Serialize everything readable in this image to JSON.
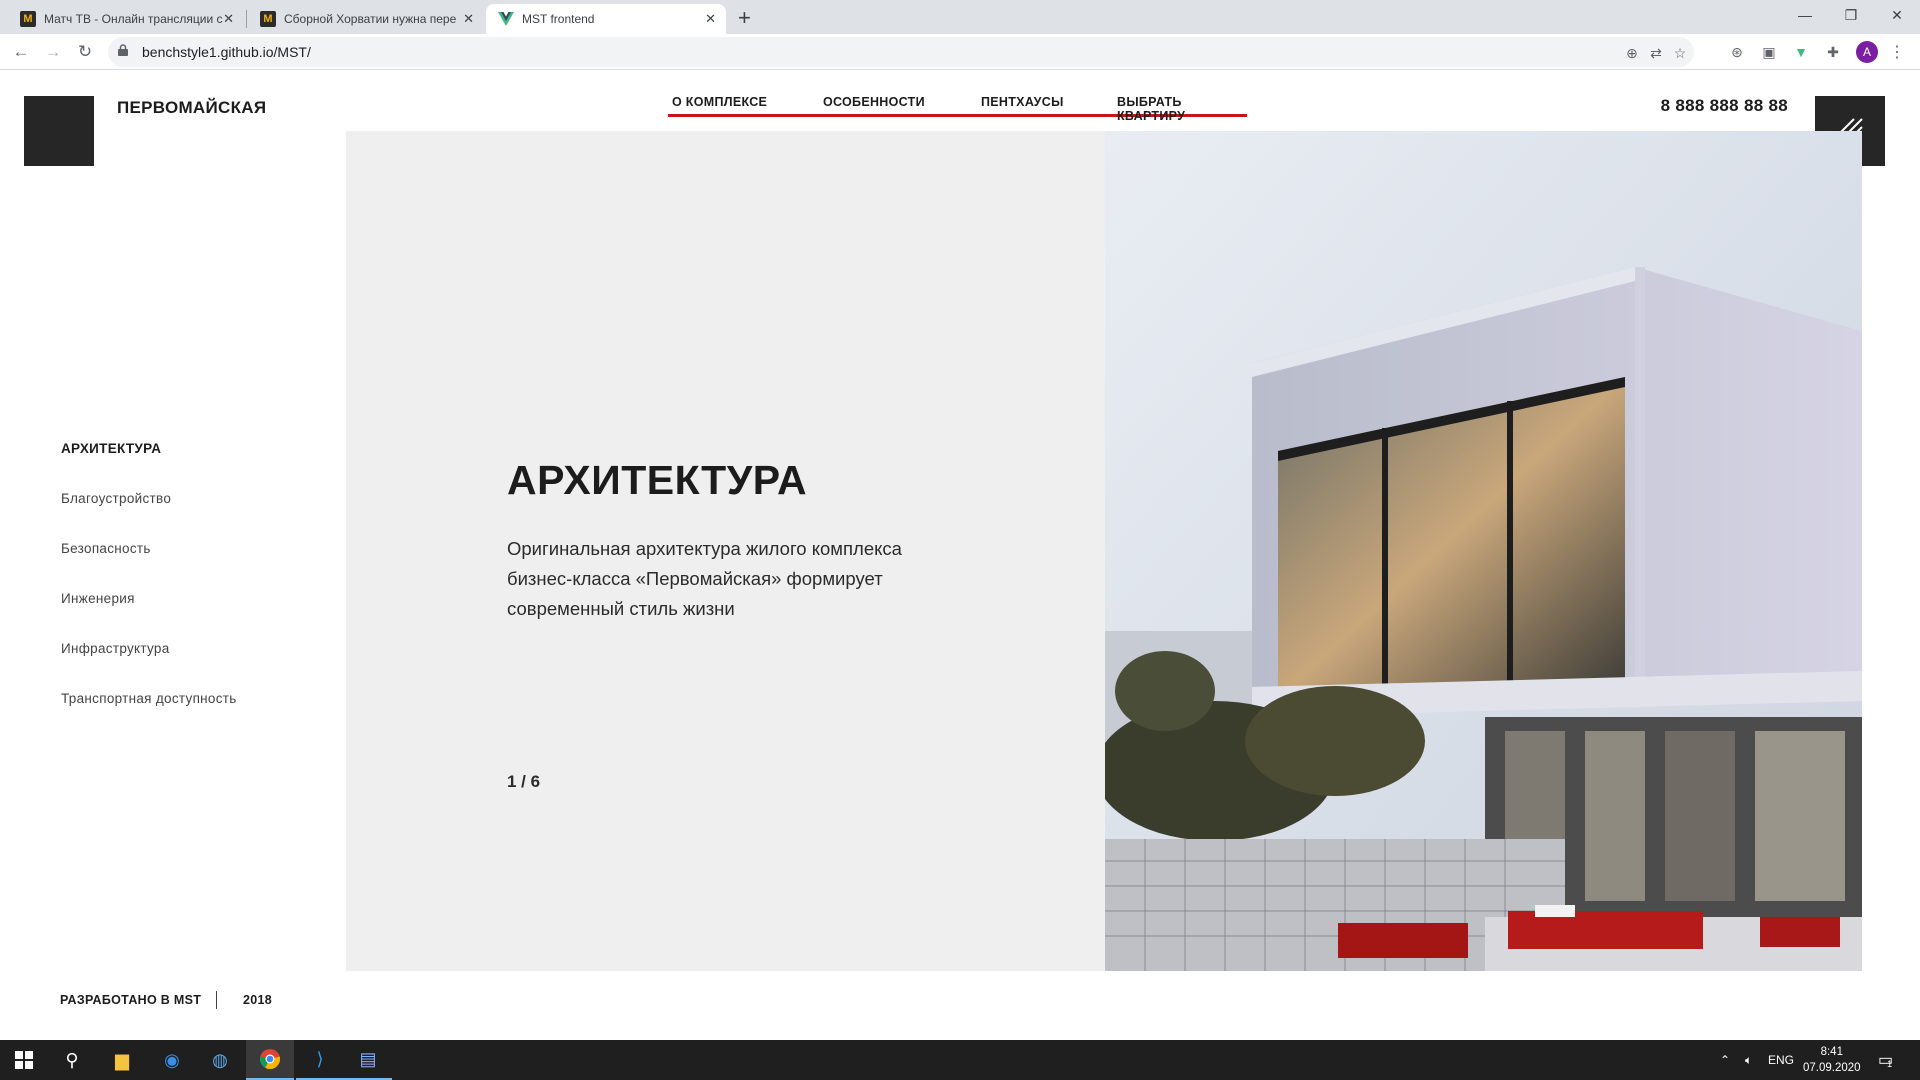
{
  "browser": {
    "tabs": [
      {
        "title": "Матч ТВ - Онлайн трансляции с",
        "favicon": "match-tv-icon",
        "active": false
      },
      {
        "title": "Сборной Хорватии нужна пере",
        "favicon": "match-tv-icon",
        "active": false
      },
      {
        "title": "MST frontend",
        "favicon": "vue-icon",
        "active": true
      }
    ],
    "url": "benchstyle1.github.io/MST/",
    "profile_initial": "A",
    "profile_color": "#7b1fa2"
  },
  "site": {
    "brand": "ПЕРВОМАЙСКАЯ",
    "nav": [
      {
        "label": "О КОМПЛЕКСЕ"
      },
      {
        "label": "ОСОБЕННОСТИ"
      },
      {
        "label": "ПЕНТХАУСЫ"
      },
      {
        "label": "ВЫБРАТЬ КВАРТИРУ"
      }
    ],
    "phone": "8 888 888 88 88",
    "accent_color": "#c4141c",
    "sidenav": [
      {
        "label": "АРХИТЕКТУРА",
        "active": true
      },
      {
        "label": "Благоустройство",
        "active": false
      },
      {
        "label": "Безопасность",
        "active": false
      },
      {
        "label": "Инженерия",
        "active": false
      },
      {
        "label": "Инфраструктура",
        "active": false
      },
      {
        "label": "Транспортная доступность",
        "active": false
      }
    ],
    "slide": {
      "title": "АРХИТЕКТУРА",
      "text": "Оригинальная архитектура жилого комплекса бизнес-класса «Первомайская» формирует современный стиль жизни",
      "counter": "1 / 6"
    },
    "footer": {
      "developer": "РАЗРАБОТАНО В MST",
      "year": "2018"
    }
  },
  "taskbar": {
    "language": "ENG",
    "time": "8:41",
    "date": "07.09.2020",
    "notification_count": "1"
  }
}
